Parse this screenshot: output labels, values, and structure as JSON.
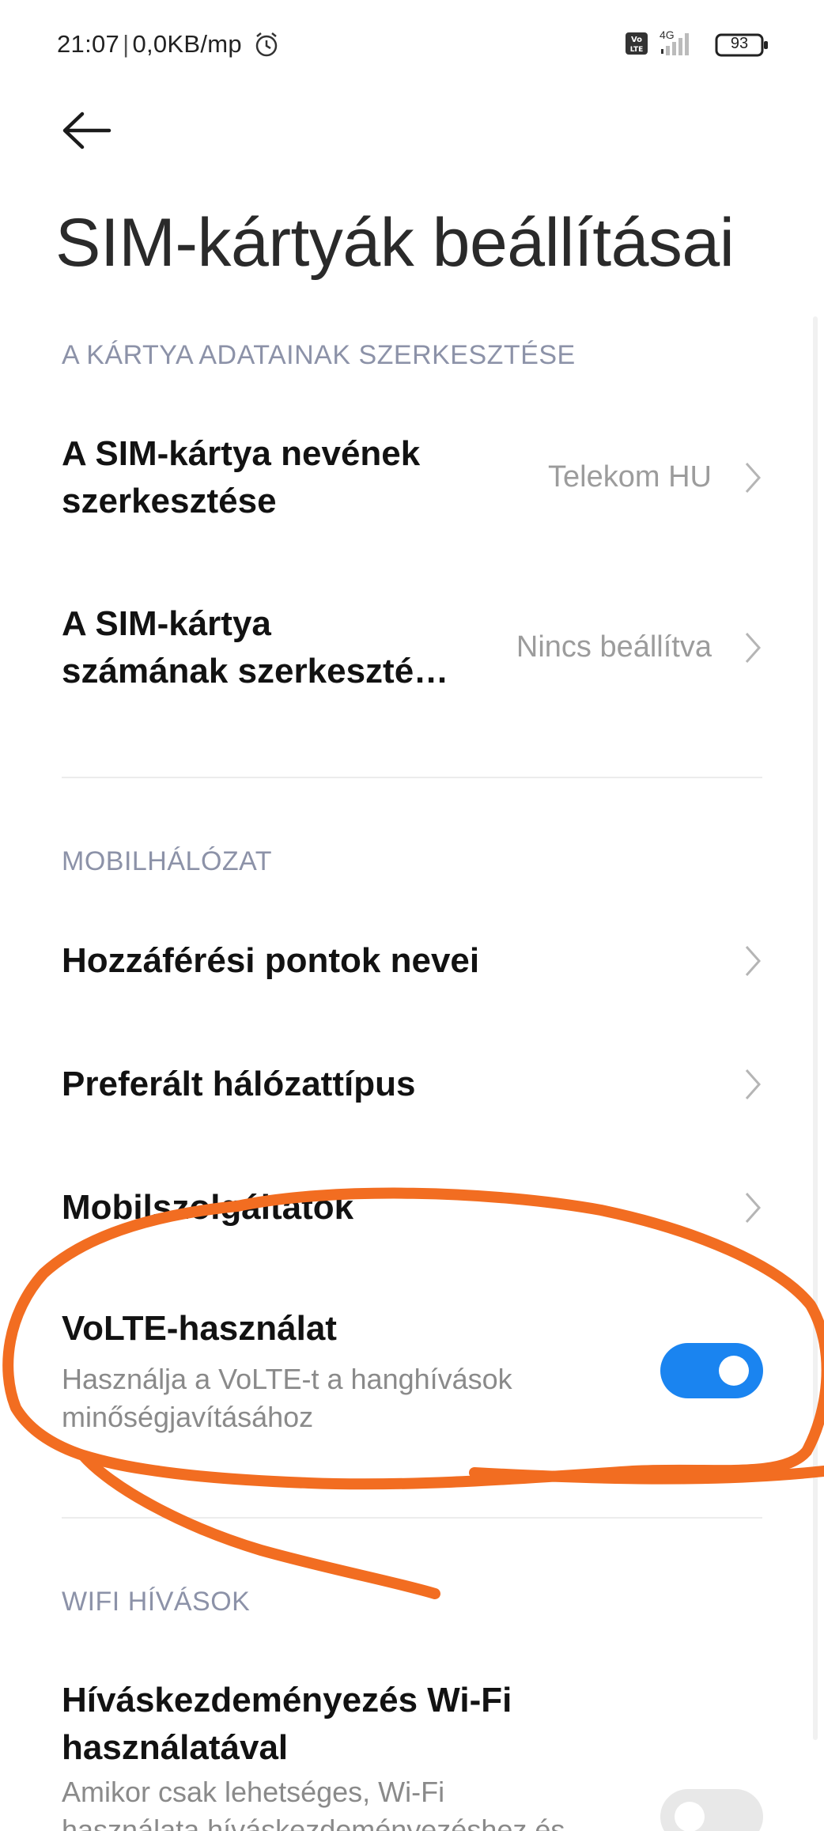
{
  "status_bar": {
    "time": "21:07",
    "separator": "|",
    "network_speed": "0,0KB/mp",
    "network_type": "4G",
    "volte_badge": "Vo LTE",
    "battery": "93",
    "icons": [
      "alarm-icon",
      "volte-icon",
      "signal-icon",
      "battery-icon"
    ]
  },
  "header": {
    "back_icon": "back-arrow-icon",
    "title": "SIM-kártyák beállításai"
  },
  "sections": {
    "card_data": {
      "header": "A KÁRTYA ADATAINAK SZERKESZTÉSE",
      "sim_name": {
        "title_line1": "A SIM-kártya nevének",
        "title_line2": "szerkesztése",
        "value": "Telekom HU"
      },
      "sim_number": {
        "title_line1": "A SIM-kártya",
        "title_line2": "számának szerkeszté…",
        "value": "Nincs beállítva"
      }
    },
    "mobile_network": {
      "header": "MOBILHÁLÓZAT",
      "apn": {
        "title": "Hozzáférési pontok nevei"
      },
      "preferred_network": {
        "title": "Preferált hálózattípus"
      },
      "operators": {
        "title": "Mobilszolgáltatók"
      },
      "volte": {
        "title": "VoLTE-használat",
        "subtitle_line1": "Használja a VoLTE-t a hanghívások",
        "subtitle_line2": "minőségjavításához",
        "enabled": true
      }
    },
    "wifi_calling": {
      "header": "WIFI HÍVÁSOK",
      "wifi_calls": {
        "title_line1": "Híváskezdeményezés Wi-Fi",
        "title_line2": "használatával",
        "subtitle_line1": "Amikor csak lehetséges, Wi-Fi",
        "subtitle_line2": "használata híváskezdeményezéshez és",
        "enabled": false
      }
    }
  },
  "colors": {
    "accent": "#1a84f0",
    "annotation": "#f26d21",
    "section_header": "#8c92a8"
  }
}
